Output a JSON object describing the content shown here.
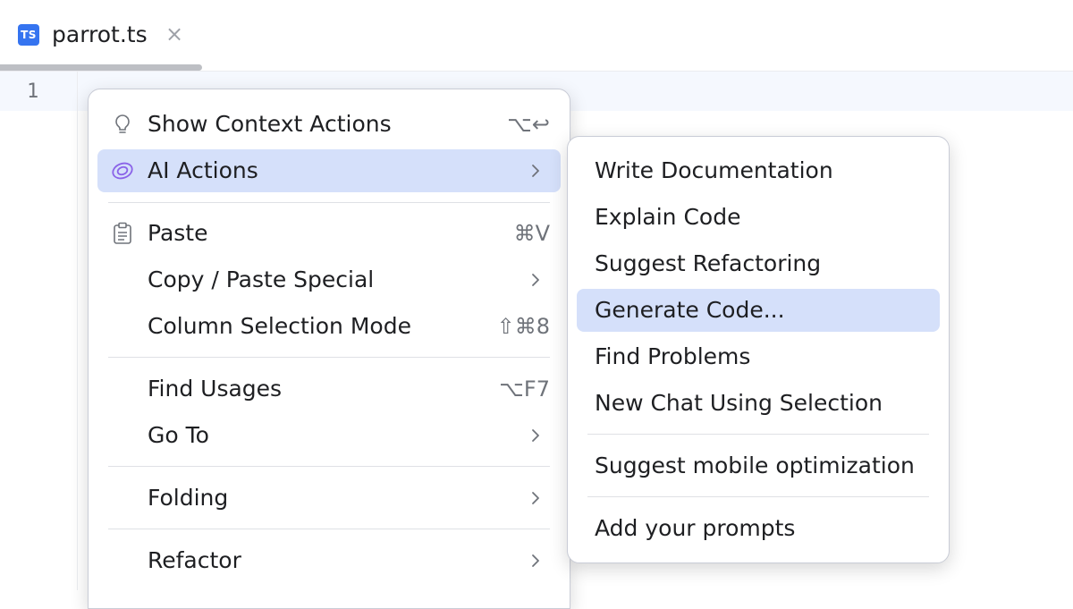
{
  "tab": {
    "icon_text": "TS",
    "file_name": "parrot.ts",
    "close_glyph": "×"
  },
  "editor": {
    "line_numbers": [
      "1"
    ]
  },
  "context_menu": {
    "items": [
      {
        "label": "Show Context Actions",
        "shortcut": "⌥↩",
        "icon": "lightbulb-icon"
      },
      {
        "label": "AI Actions",
        "submenu": true,
        "icon": "ai-assistant-icon",
        "selected": true
      },
      {
        "label": "Paste",
        "shortcut": "⌘V",
        "icon": "clipboard-icon"
      },
      {
        "label": "Copy / Paste Special",
        "submenu": true
      },
      {
        "label": "Column Selection Mode",
        "shortcut": "⇧⌘8"
      },
      {
        "label": "Find Usages",
        "shortcut": "⌥F7"
      },
      {
        "label": "Go To",
        "submenu": true
      },
      {
        "label": "Folding",
        "submenu": true
      },
      {
        "label": "Refactor",
        "submenu": true
      }
    ]
  },
  "ai_submenu": {
    "items": [
      {
        "label": "Write Documentation"
      },
      {
        "label": "Explain Code"
      },
      {
        "label": "Suggest Refactoring"
      },
      {
        "label": "Generate Code...",
        "selected": true
      },
      {
        "label": "Find Problems"
      },
      {
        "label": "New Chat Using Selection"
      },
      {
        "label": "Suggest mobile optimization"
      },
      {
        "label": "Add your prompts"
      }
    ]
  },
  "colors": {
    "accent": "#3574f0",
    "selection": "#d5e0fa",
    "ai_icon": "#8a63e8",
    "text": "#1e1f22",
    "muted": "#6f737a"
  }
}
